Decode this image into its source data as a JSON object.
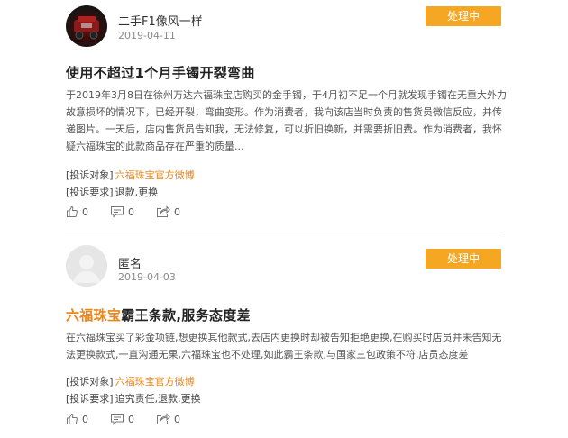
{
  "posts": [
    {
      "username": "二手F1像风一样",
      "date": "2019-04-11",
      "status": "处理中",
      "title_highlight": "",
      "title": "使用不超过1个月手镯开裂弯曲",
      "body": "于2019年3月8日在徐州万达六福珠宝店购买的金手镯，于4月初不足一个月就发现手镯在无重大外力故意损坏的情况下，已经开裂，弯曲变形。作为消费者，我向该店当时负责的售货员微信反应，并传递图片。一天后，店内售货员告知我，无法修复，可以折旧换新，并需要折旧费。作为消费者，我怀疑六福珠宝的此款商品存在严重的质量...",
      "target_label": "[投诉对象]",
      "target_value": "六福珠宝官方微博",
      "demand_label": "[投诉要求]",
      "demand_value": "退款,更换",
      "likes": "0",
      "comments": "0",
      "shares": "0"
    },
    {
      "username": "匿名",
      "date": "2019-04-03",
      "status": "处理中",
      "title_highlight": "六福珠宝",
      "title": "霸王条款,服务态度差",
      "body": "在六福珠宝买了彩金项链,想更换其他款式,去店内更换时却被告知拒绝更换,在购买时店员并未告知无法更换款式,一直沟通无果,六福珠宝也不处理,如此霸王条款,与国家三包政策不符,店员态度差",
      "target_label": "[投诉对象]",
      "target_value": "六福珠宝官方微博",
      "demand_label": "[投诉要求]",
      "demand_value": "追究责任,退款,更换",
      "likes": "0",
      "comments": "0",
      "shares": "0"
    }
  ],
  "icons": {
    "avatar_1": "red-car-engine-avatar",
    "avatar_2": "default-anonymous-avatar",
    "like": "thumbs-up-icon",
    "comment": "comment-bubble-icon",
    "share": "share-arrow-icon"
  },
  "colors": {
    "badge": "#f5a623",
    "highlight": "#e8871e"
  }
}
